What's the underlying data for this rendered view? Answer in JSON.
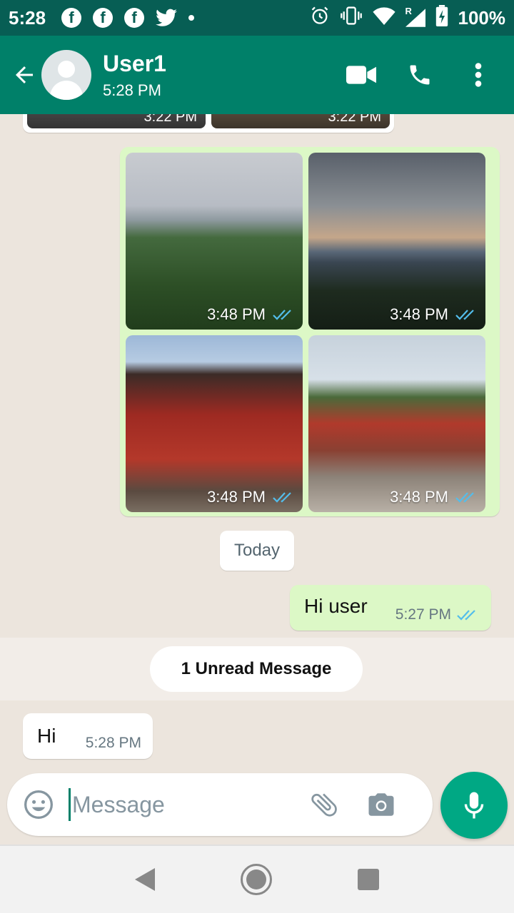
{
  "status_bar": {
    "time": "5:28",
    "battery": "100%",
    "fb_glyph": "f",
    "network_letter": "R"
  },
  "header": {
    "contact_name": "User1",
    "subtitle": "5:28 PM"
  },
  "chat": {
    "prev_album_times": [
      "3:22 PM",
      "3:22 PM"
    ],
    "album_photos": [
      {
        "time": "3:48 PM",
        "status": "double-check-icon"
      },
      {
        "time": "3:48 PM",
        "status": "double-check-icon"
      },
      {
        "time": "3:48 PM",
        "status": "double-check-icon"
      },
      {
        "time": "3:48 PM",
        "status": "double-check-icon"
      }
    ],
    "date_divider": "Today",
    "outgoing": {
      "text": "Hi user",
      "time": "5:27 PM"
    },
    "unread_banner": "1 Unread Message",
    "incoming": {
      "text": "Hi",
      "time": "5:28 PM"
    }
  },
  "composer": {
    "placeholder": "Message"
  },
  "colors": {
    "header": "#008069",
    "status_bar": "#075E54",
    "outgoing_bubble": "#DCF8C6",
    "accent": "#00A884",
    "read_tick": "#53BDEB"
  }
}
